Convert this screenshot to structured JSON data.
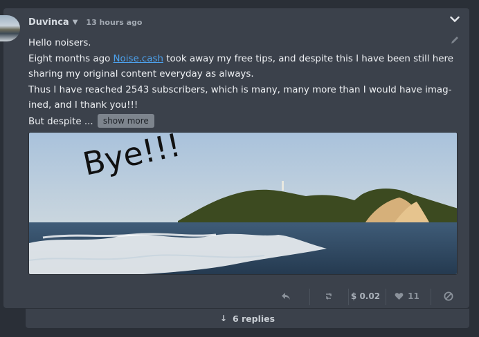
{
  "post": {
    "username": "Duvinca",
    "timestamp": "13 hours ago",
    "greeting": "Hello noisers.",
    "line2_before": "Eight months ago ",
    "line2_link": "Noise.cash",
    "line2_after": " took away my free tips, and despite this I have been still here",
    "line3": "sharing my original content everyday as always.",
    "line4": "Thus I have reached 2543 subscribers, which is many, many more than I would have imag-",
    "line5": "ined, and I thank you!!!",
    "line6": "But despite ...",
    "show_more_label": "show more",
    "image_caption_text": "Bye!!!"
  },
  "actions": {
    "reply_icon": "reply-icon",
    "repost_icon": "repost-icon",
    "tip_amount": "$ 0.02",
    "likes": "11",
    "block_icon": "block-icon"
  },
  "replies": {
    "label": "6 replies"
  },
  "colors": {
    "background": "#2a2f37",
    "card": "#3b414b",
    "link": "#4da2ee",
    "muted": "#8b929b"
  }
}
